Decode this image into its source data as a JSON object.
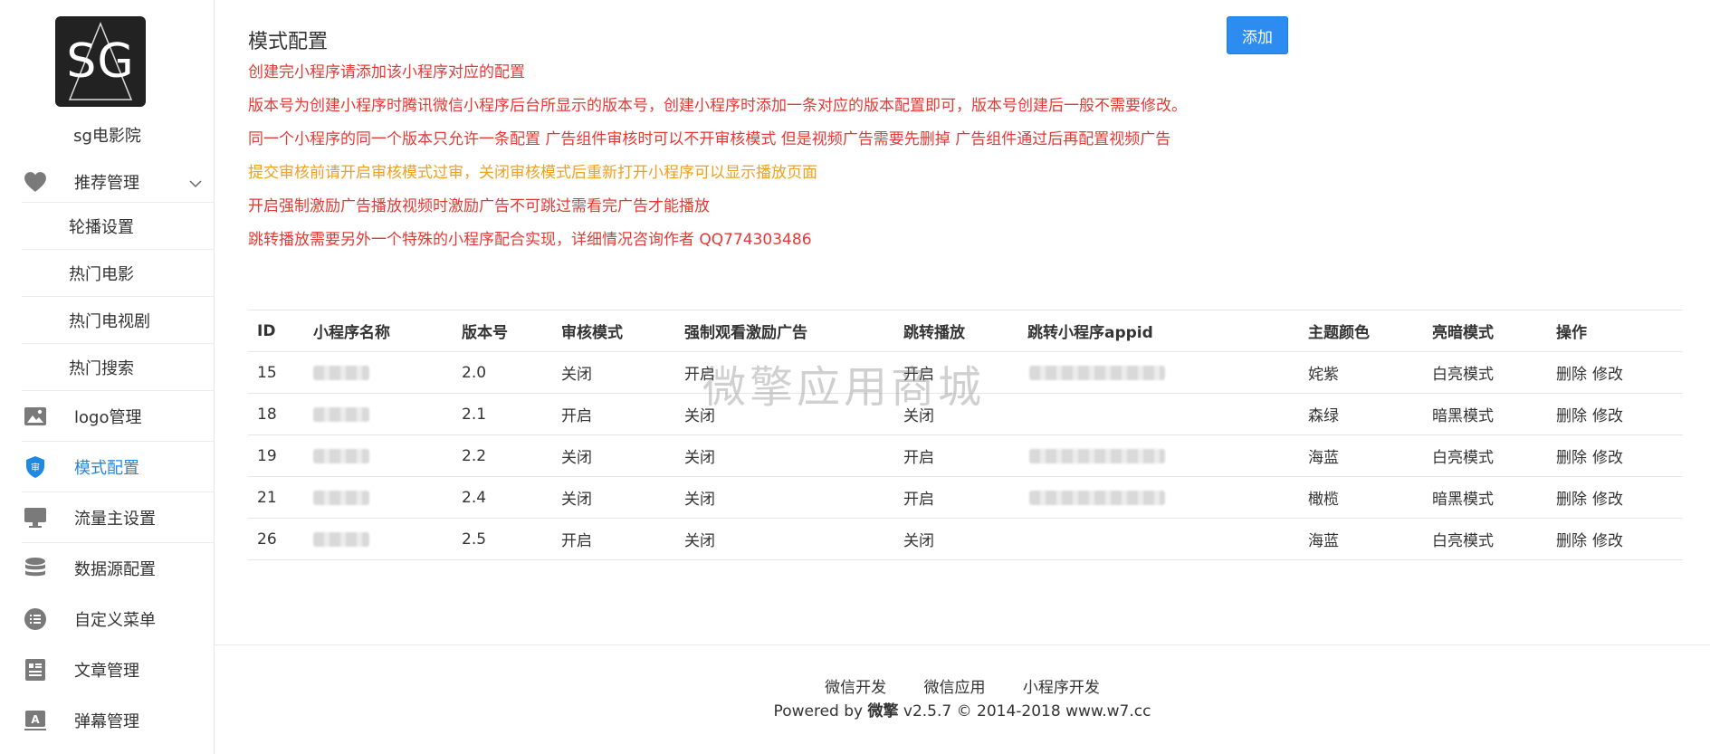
{
  "brand": {
    "logo_text": "SG",
    "name": "sg电影院"
  },
  "sidebar": {
    "items": [
      {
        "label": "推荐管理",
        "icon": "heart-icon",
        "expanded": true
      },
      {
        "label": "轮播设置",
        "sub": true
      },
      {
        "label": "热门电影",
        "sub": true
      },
      {
        "label": "热门电视剧",
        "sub": true
      },
      {
        "label": "热门搜索",
        "sub": true
      },
      {
        "label": "logo管理",
        "icon": "image-icon"
      },
      {
        "label": "模式配置",
        "icon": "shield-icon",
        "active": true
      },
      {
        "label": "流量主设置",
        "icon": "monitor-icon"
      },
      {
        "label": "数据源配置",
        "icon": "database-icon"
      },
      {
        "label": "自定义菜单",
        "icon": "list-icon"
      },
      {
        "label": "文章管理",
        "icon": "article-icon"
      },
      {
        "label": "弹幕管理",
        "icon": "barrage-icon"
      }
    ]
  },
  "main": {
    "title": "模式配置",
    "add_label": "添加",
    "notes": [
      "创建完小程序请添加该小程序对应的配置",
      "版本号为创建小程序时腾讯微信小程序后台所显示的版本号，创建小程序时添加一条对应的版本配置即可，版本号创建后一般不需要修改。",
      "同一个小程序的同一个版本只允许一条配置 广告组件审核时可以不开审核模式 但是视频广告需要先删掉 广告组件通过后再配置视频广告",
      "提交审核前请开启审核模式过审，关闭审核模式后重新打开小程序可以显示播放页面",
      "开启强制激励广告播放视频时激励广告不可跳过需看完广告才能播放",
      "跳转播放需要另外一个特殊的小程序配合实现，详细情况咨询作者 QQ774303486"
    ],
    "table": {
      "headers": [
        "ID",
        "小程序名称",
        "版本号",
        "审核模式",
        "强制观看激励广告",
        "跳转播放",
        "跳转小程序appid",
        "主题颜色",
        "亮暗模式",
        "操作"
      ],
      "rows": [
        {
          "id": "15",
          "version": "2.0",
          "audit": "关闭",
          "force_ad": "开启",
          "jump": "开启",
          "has_appid": true,
          "theme": "姹紫",
          "mode": "白亮模式"
        },
        {
          "id": "18",
          "version": "2.1",
          "audit": "开启",
          "force_ad": "关闭",
          "jump": "关闭",
          "has_appid": false,
          "theme": "森绿",
          "mode": "暗黑模式"
        },
        {
          "id": "19",
          "version": "2.2",
          "audit": "关闭",
          "force_ad": "关闭",
          "jump": "开启",
          "has_appid": true,
          "theme": "海蓝",
          "mode": "白亮模式"
        },
        {
          "id": "21",
          "version": "2.4",
          "audit": "关闭",
          "force_ad": "关闭",
          "jump": "开启",
          "has_appid": true,
          "theme": "橄榄",
          "mode": "暗黑模式"
        },
        {
          "id": "26",
          "version": "2.5",
          "audit": "开启",
          "force_ad": "关闭",
          "jump": "关闭",
          "has_appid": false,
          "theme": "海蓝",
          "mode": "白亮模式"
        }
      ],
      "delete_label": "删除",
      "edit_label": "修改"
    }
  },
  "watermark": "微擎应用商城",
  "footer": {
    "links": [
      "微信开发",
      "微信应用",
      "小程序开发"
    ],
    "copy_prefix": "Powered by ",
    "copy_brand": "微擎",
    "copy_suffix": " v2.5.7 © 2014-2018 www.w7.cc"
  },
  "colors": {
    "accent": "#2d8cf0",
    "active_nav": "#1e88e5",
    "note_red": "#e53935",
    "note_orange": "#f0a020"
  }
}
